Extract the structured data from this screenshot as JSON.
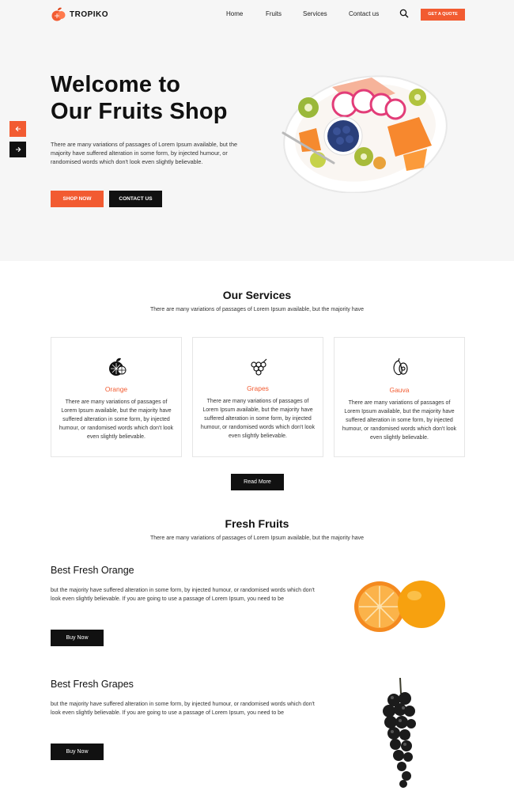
{
  "brand": {
    "name": "TROPIKO",
    "accent": "#f25b31",
    "dark": "#111111"
  },
  "nav": {
    "items": [
      {
        "label": "Home"
      },
      {
        "label": "Fruits"
      },
      {
        "label": "Services"
      },
      {
        "label": "Contact us"
      }
    ],
    "search_icon": "search-icon",
    "quote_label": "GET A QUOTE"
  },
  "hero": {
    "title_line1": "Welcome to",
    "title_line2": "Our Fruits Shop",
    "text": "There are many variations of passages of Lorem Ipsum available, but the majority have suffered alteration in some form, by injected humour, or randomised words which don't look even slightly believable.",
    "shop_label": "SHOP NOW",
    "contact_label": "CONTACT US",
    "prev_icon": "arrow-left-icon",
    "next_icon": "arrow-right-icon"
  },
  "services": {
    "title": "Our Services",
    "subtitle": "There are many variations of passages of Lorem Ipsum available, but the majority have",
    "cards": [
      {
        "icon": "orange-icon",
        "title": "Orange",
        "text": "There are many variations of passages of Lorem Ipsum available, but the majority have suffered alteration in some form, by injected humour, or randomised words which don't look even slightly believable."
      },
      {
        "icon": "grapes-icon",
        "title": "Grapes",
        "text": "There are many variations of passages of Lorem Ipsum available, but the majority have suffered alteration in some form, by injected humour, or randomised words which don't look even slightly believable."
      },
      {
        "icon": "guava-icon",
        "title": "Gauva",
        "text": "There are many variations of passages of Lorem Ipsum available, but the majority have suffered alteration in some form, by injected humour, or randomised words which don't look even slightly believable."
      }
    ],
    "read_more_label": "Read More"
  },
  "fresh": {
    "title": "Fresh Fruits",
    "subtitle": "There are many variations of passages of Lorem Ipsum available, but the majority have",
    "items": [
      {
        "title": "Best Fresh Orange",
        "text": "but the majority have suffered alteration in some form, by injected humour, or randomised words which don't look even slightly believable. If you are going to use a passage of Lorem Ipsum, you need to be",
        "buy_label": "Buy Now"
      },
      {
        "title": "Best Fresh Grapes",
        "text": "but the majority have suffered alteration in some form, by injected humour, or randomised words which don't look even slightly believable. If you are going to use a passage of Lorem Ipsum, you need to be",
        "buy_label": "Buy Now"
      }
    ]
  }
}
